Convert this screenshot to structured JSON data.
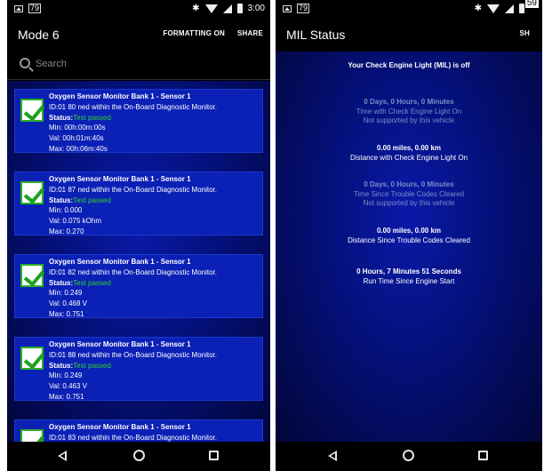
{
  "left": {
    "status": {
      "temp": "79",
      "time": "3:00"
    },
    "app_title": "Mode 6",
    "actions": {
      "formatting": "FORMATTING ON",
      "share": "SHARE"
    },
    "search_placeholder": "Search",
    "cards": [
      {
        "title": "Oxygen Sensor Monitor Bank 1 - Sensor 1",
        "id_line": "ID:01 80   ned within the On-Board Diagnostic Monitor.",
        "status_label": "Status:",
        "status_value": "Test passed",
        "min": "Min:  00h:00m:00s",
        "val": "Val:  00h:01m:40s",
        "max": "Max:  00h:06m:40s"
      },
      {
        "title": "Oxygen Sensor Monitor Bank 1 - Sensor 1",
        "id_line": "ID:01 87   ned within the On-Board Diagnostic Monitor.",
        "status_label": "Status:",
        "status_value": "Test passed",
        "min": "Min:  0.000",
        "val": "Val:  0.075 kOhm",
        "max": "Max:  0.270"
      },
      {
        "title": "Oxygen Sensor Monitor Bank 1 - Sensor 1",
        "id_line": "ID:01 82   ned within the On-Board Diagnostic Monitor.",
        "status_label": "Status:",
        "status_value": "Test passed",
        "min": "Min:  0.249",
        "val": "Val:  0.468 V",
        "max": "Max:  0.751"
      },
      {
        "title": "Oxygen Sensor Monitor Bank 1 - Sensor 1",
        "id_line": "ID:01 88   ned within the On-Board Diagnostic Monitor.",
        "status_label": "Status:",
        "status_value": "Test passed",
        "min": "Min:  0.249",
        "val": "Val:  0.463 V",
        "max": "Max:  0.751"
      },
      {
        "title": "Oxygen Sensor Monitor Bank 1 - Sensor 1",
        "id_line": "ID:01 83   ned within the On-Board Diagnostic Monitor."
      }
    ]
  },
  "right": {
    "status": {
      "temp": "79",
      "corner": "59"
    },
    "app_title": "MIL Status",
    "share_partial": "SH",
    "mil_header": "Your Check Engine Light (MIL) is off",
    "blocks": [
      {
        "value": "0 Days, 0 Hours, 0 Minutes",
        "label": "Time with Check Engine Light On",
        "note": "Not supported by this vehicle"
      },
      {
        "value": "0.00 miles, 0.00 km",
        "label": "Distance with Check Engine Light On"
      },
      {
        "value": "0 Days, 0 Hours, 0 Minutes",
        "label": "Time Since Trouble Codes Cleared",
        "note": "Not supported by this vehicle"
      },
      {
        "value": "0.00 miles, 0.00 km",
        "label": "Distance Since Trouble Codes Cleared"
      },
      {
        "value": "0 Hours, 7 Minutes 51 Seconds",
        "label": "Run Time Since Engine Start"
      }
    ]
  }
}
